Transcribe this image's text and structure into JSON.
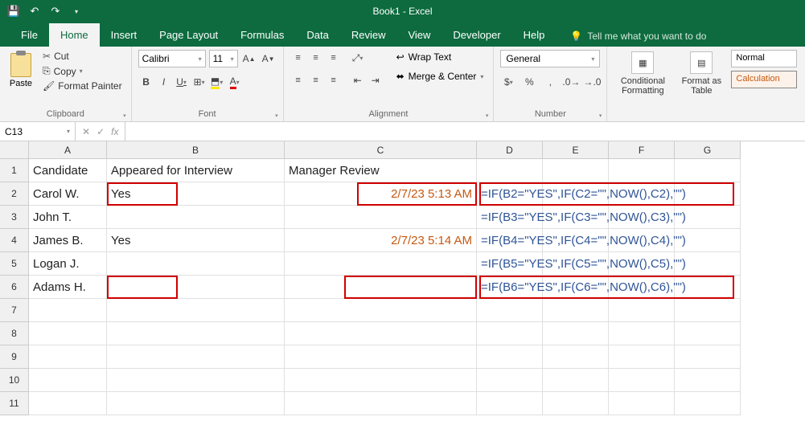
{
  "titlebar": {
    "title": "Book1 - Excel"
  },
  "tabs": [
    "File",
    "Home",
    "Insert",
    "Page Layout",
    "Formulas",
    "Data",
    "Review",
    "View",
    "Developer",
    "Help"
  ],
  "active_tab": "Home",
  "tell_me": "Tell me what you want to do",
  "clipboard": {
    "paste": "Paste",
    "cut": "Cut",
    "copy": "Copy",
    "format_painter": "Format Painter",
    "group": "Clipboard"
  },
  "font": {
    "name": "Calibri",
    "size": "11",
    "group": "Font"
  },
  "alignment": {
    "wrap": "Wrap Text",
    "merge": "Merge & Center",
    "group": "Alignment"
  },
  "number": {
    "format": "General",
    "group": "Number"
  },
  "styles": {
    "cond": "Conditional Formatting",
    "table": "Format as Table",
    "normal": "Normal",
    "calc": "Calculation"
  },
  "namebox": "C13",
  "columns": [
    "A",
    "B",
    "C",
    "D",
    "E",
    "F",
    "G"
  ],
  "rows": [
    "1",
    "2",
    "3",
    "4",
    "5",
    "6",
    "7",
    "8",
    "9",
    "10",
    "11"
  ],
  "cells": {
    "A1": "Candidate",
    "B1": "Appeared for Interview",
    "C1": "Manager Review",
    "A2": "Carol W.",
    "B2": "Yes",
    "C2": "2/7/23 5:13 AM",
    "D2": "=IF(B2=\"YES\",IF(C2=\"\",NOW(),C2),\"\")",
    "A3": "John T.",
    "D3": "=IF(B3=\"YES\",IF(C3=\"\",NOW(),C3),\"\")",
    "A4": "James B.",
    "B4": "Yes",
    "C4": "2/7/23 5:14 AM",
    "D4": "=IF(B4=\"YES\",IF(C4=\"\",NOW(),C4),\"\")",
    "A5": "Logan J.",
    "D5": "=IF(B5=\"YES\",IF(C5=\"\",NOW(),C5),\"\")",
    "A6": "Adams H.",
    "D6": "=IF(B6=\"YES\",IF(C6=\"\",NOW(),C6),\"\")"
  }
}
